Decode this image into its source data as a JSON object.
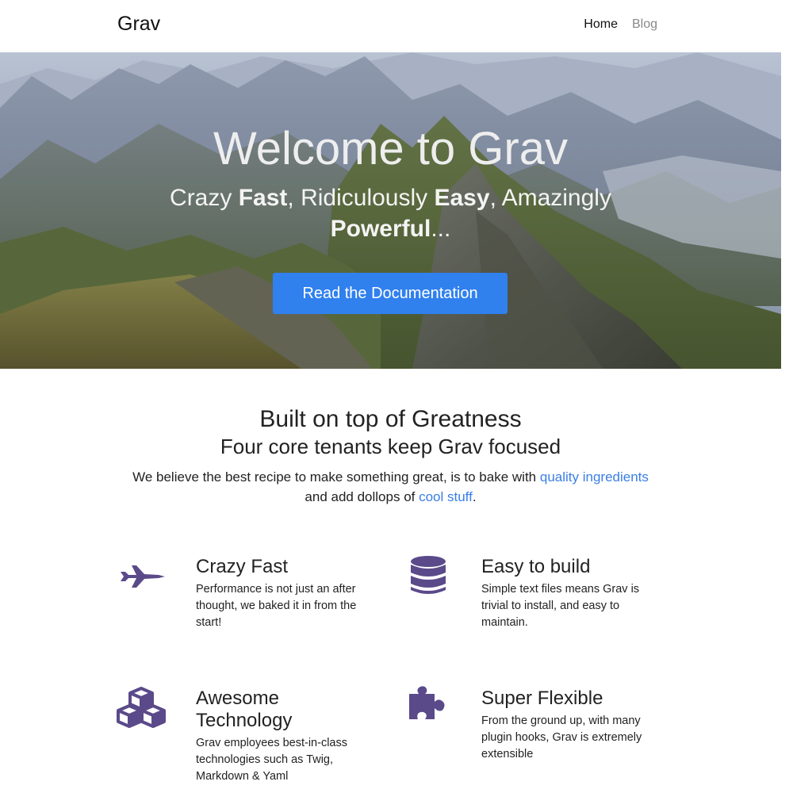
{
  "navbar": {
    "brand": "Grav",
    "links": [
      {
        "label": "Home"
      },
      {
        "label": "Blog"
      }
    ]
  },
  "hero": {
    "title": "Welcome to Grav",
    "subtitle": {
      "p1": "Crazy ",
      "b1": "Fast",
      "p2": ", Ridiculously ",
      "b2": "Easy",
      "p3": ", Amazingly ",
      "b3": "Powerful",
      "p4": "..."
    },
    "button_label": "Read the Documentation"
  },
  "section": {
    "title": "Built on top of Greatness",
    "subtitle": "Four core tenants keep Grav focused",
    "desc_part1": "We believe the best recipe to make something great, is to bake with ",
    "link1": "quality ingredients",
    "desc_part2": " and add dollops of ",
    "link2": "cool stuff",
    "desc_part3": "."
  },
  "features": [
    {
      "title": "Crazy Fast",
      "desc": "Performance is not just an after thought, we baked it in from the start!",
      "icon": "fighter-jet-icon"
    },
    {
      "title": "Easy to build",
      "desc": "Simple text files means Grav is trivial to install, and easy to maintain.",
      "icon": "database-icon"
    },
    {
      "title": "Awesome Technology",
      "desc": "Grav employees best-in-class technologies such as Twig, Markdown & Yaml",
      "icon": "cubes-icon"
    },
    {
      "title": "Super Flexible",
      "desc": "From the ground up, with many plugin hooks, Grav is extremely extensible",
      "icon": "puzzle-piece-icon"
    }
  ],
  "colors": {
    "accent": "#3080ee",
    "link": "#3a7ee6",
    "icon": "#5b4a8a"
  }
}
